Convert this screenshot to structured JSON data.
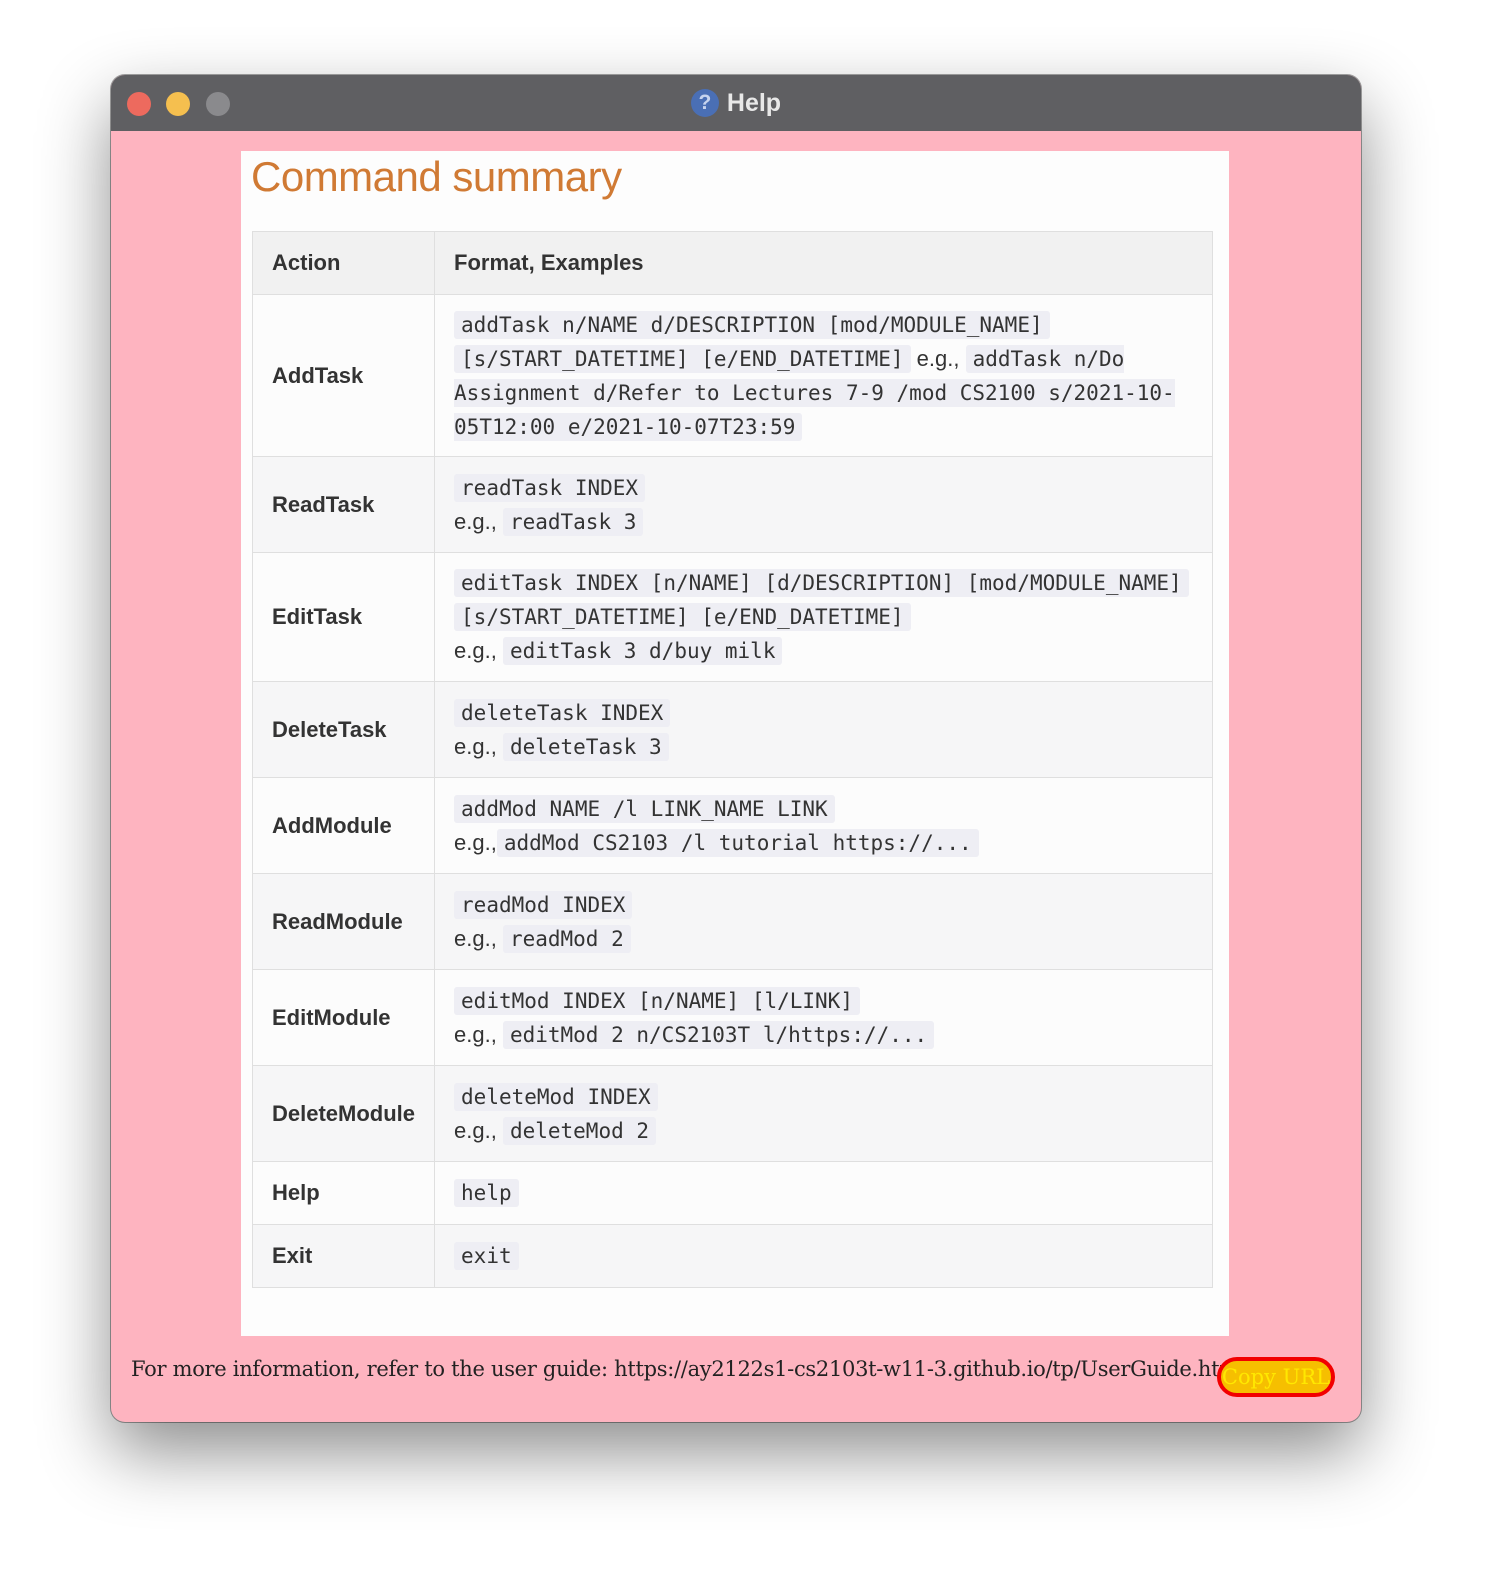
{
  "window": {
    "title": "Help"
  },
  "heading": "Command summary",
  "table": {
    "headers": {
      "action": "Action",
      "format": "Format, Examples"
    },
    "rows": [
      {
        "action": "AddTask",
        "parts": [
          {
            "t": "code",
            "v": "addTask n/NAME d/DESCRIPTION [mod/MODULE_NAME]"
          },
          {
            "t": "code",
            "v": "[s/START_DATETIME] [e/END_DATETIME]"
          },
          {
            "t": "text",
            "v": " e.g., "
          },
          {
            "t": "code",
            "v": "addTask n/Do Assignment d/Refer to Lectures 7-9 /mod CS2100 s/2021-10-05T12:00 e/2021-10-07T23:59"
          }
        ]
      },
      {
        "action": "ReadTask",
        "parts": [
          {
            "t": "code",
            "v": "readTask INDEX"
          },
          {
            "t": "br"
          },
          {
            "t": "text",
            "v": "e.g., "
          },
          {
            "t": "code",
            "v": "readTask 3"
          }
        ]
      },
      {
        "action": "EditTask",
        "parts": [
          {
            "t": "code",
            "v": "editTask INDEX [n/NAME] [d/DESCRIPTION] [mod/MODULE_NAME]"
          },
          {
            "t": "code",
            "v": "[s/START_DATETIME] [e/END_DATETIME]"
          },
          {
            "t": "br"
          },
          {
            "t": "text",
            "v": "e.g., "
          },
          {
            "t": "code",
            "v": "editTask 3 d/buy milk"
          }
        ]
      },
      {
        "action": "DeleteTask",
        "parts": [
          {
            "t": "code",
            "v": "deleteTask INDEX"
          },
          {
            "t": "br"
          },
          {
            "t": "text",
            "v": "e.g., "
          },
          {
            "t": "code",
            "v": "deleteTask 3"
          }
        ]
      },
      {
        "action": "AddModule",
        "parts": [
          {
            "t": "code",
            "v": "addMod NAME /l LINK_NAME LINK"
          },
          {
            "t": "br"
          },
          {
            "t": "text",
            "v": "e.g.,"
          },
          {
            "t": "code",
            "v": "addMod CS2103 /l tutorial https://..."
          }
        ]
      },
      {
        "action": "ReadModule",
        "parts": [
          {
            "t": "code",
            "v": "readMod INDEX"
          },
          {
            "t": "br"
          },
          {
            "t": "text",
            "v": "e.g., "
          },
          {
            "t": "code",
            "v": "readMod 2"
          }
        ]
      },
      {
        "action": "EditModule",
        "parts": [
          {
            "t": "code",
            "v": "editMod INDEX [n/NAME] [l/LINK]"
          },
          {
            "t": "br"
          },
          {
            "t": "text",
            "v": "e.g., "
          },
          {
            "t": "code",
            "v": "editMod 2 n/CS2103T l/https://..."
          }
        ]
      },
      {
        "action": "DeleteModule",
        "parts": [
          {
            "t": "code",
            "v": "deleteMod INDEX"
          },
          {
            "t": "br"
          },
          {
            "t": "text",
            "v": "e.g., "
          },
          {
            "t": "code",
            "v": "deleteMod 2"
          }
        ]
      },
      {
        "action": "Help",
        "parts": [
          {
            "t": "code",
            "v": "help"
          }
        ]
      },
      {
        "action": "Exit",
        "parts": [
          {
            "t": "code",
            "v": "exit"
          }
        ]
      }
    ]
  },
  "footer": {
    "text": "For more information, refer to the user guide: https://ay2122s1-cs2103t-w11-3.github.io/tp/UserGuide.html",
    "copy_button": "Copy URL"
  },
  "colors": {
    "background": "#feb4c0",
    "heading": "#d07a34",
    "button_fill": "#f6bf00",
    "button_border": "#f20000",
    "button_text": "#ffe800"
  }
}
